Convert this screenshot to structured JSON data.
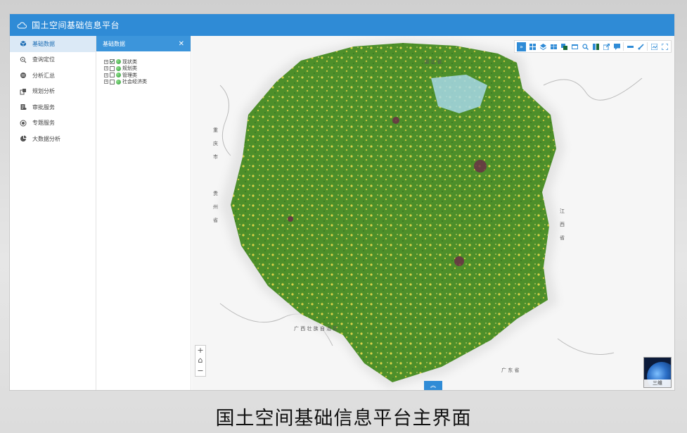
{
  "app": {
    "title": "国土空间基础信息平台"
  },
  "nav": {
    "items": [
      {
        "label": "基础数据",
        "icon": "cube-icon",
        "active": true
      },
      {
        "label": "查询定位",
        "icon": "search-location-icon",
        "active": false
      },
      {
        "label": "分析汇总",
        "icon": "database-icon",
        "active": false
      },
      {
        "label": "规划分析",
        "icon": "layers-icon",
        "active": false
      },
      {
        "label": "审批服务",
        "icon": "document-icon",
        "active": false
      },
      {
        "label": "专题服务",
        "icon": "target-icon",
        "active": false
      },
      {
        "label": "大数据分析",
        "icon": "pie-chart-icon",
        "active": false
      }
    ]
  },
  "layers": {
    "title": "基础数据",
    "close_label": "✕",
    "items": [
      {
        "label": "现状类",
        "checked": true
      },
      {
        "label": "规划类",
        "checked": false
      },
      {
        "label": "管理类",
        "checked": false
      },
      {
        "label": "社会经济类",
        "checked": false
      }
    ]
  },
  "map": {
    "labels": {
      "hubei": "湖 北 省",
      "chongqing": "重 庆 市",
      "guizhou": "贵 州 省",
      "jiangxi": "江 西 省",
      "guangxi": "广 西 壮 族 自 治 区",
      "guangdong": "广 东 省"
    },
    "zoom_in": "+",
    "home": "⌂",
    "zoom_out": "−",
    "collapse": "︽",
    "view3d_label": "三维"
  },
  "toolbar": {
    "expand_icon": "»",
    "tools": [
      "grid-icon",
      "layers-icon",
      "table-icon",
      "stack-icon",
      "window-icon",
      "search-icon",
      "compare-icon",
      "export-icon",
      "comment-icon",
      "ruler-icon",
      "clear-icon",
      "print-icon",
      "fullscreen-icon"
    ]
  },
  "caption": "国土空间基础信息平台主界面"
}
